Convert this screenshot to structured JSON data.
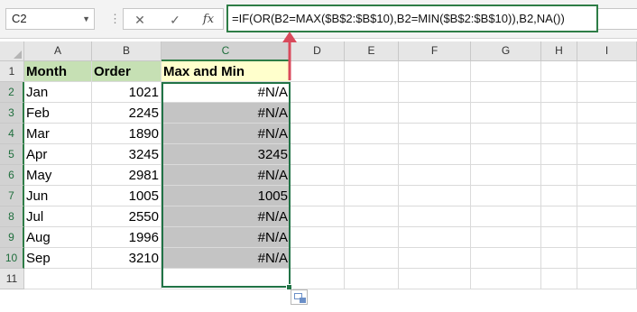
{
  "formula_bar": {
    "name_box": "C2",
    "cancel_icon": "✕",
    "enter_icon": "✓",
    "fx_label": "fx",
    "formula": "=IF(OR(B2=MAX($B$2:$B$10),B2=MIN($B$2:$B$10)),B2,NA())"
  },
  "columns": [
    "A",
    "B",
    "C",
    "D",
    "E",
    "F",
    "G",
    "H",
    "I"
  ],
  "rows": [
    "1",
    "2",
    "3",
    "4",
    "5",
    "6",
    "7",
    "8",
    "9",
    "10",
    "11"
  ],
  "table": {
    "headers": [
      "Month",
      "Order",
      "Max and Min"
    ],
    "data": [
      [
        "Jan",
        "1021",
        "#N/A"
      ],
      [
        "Feb",
        "2245",
        "#N/A"
      ],
      [
        "Mar",
        "1890",
        "#N/A"
      ],
      [
        "Apr",
        "3245",
        "3245"
      ],
      [
        "May",
        "2981",
        "#N/A"
      ],
      [
        "Jun",
        "1005",
        "1005"
      ],
      [
        "Jul",
        "2550",
        "#N/A"
      ],
      [
        "Aug",
        "1996",
        "#N/A"
      ],
      [
        "Sep",
        "3210",
        "#N/A"
      ]
    ]
  },
  "colors": {
    "selection": "#217346",
    "header_fill_ab": "#c6e0b4",
    "header_fill_c": "#ffffcc",
    "result_fill": "#c4c4c4",
    "arrow": "#d94a5c"
  }
}
